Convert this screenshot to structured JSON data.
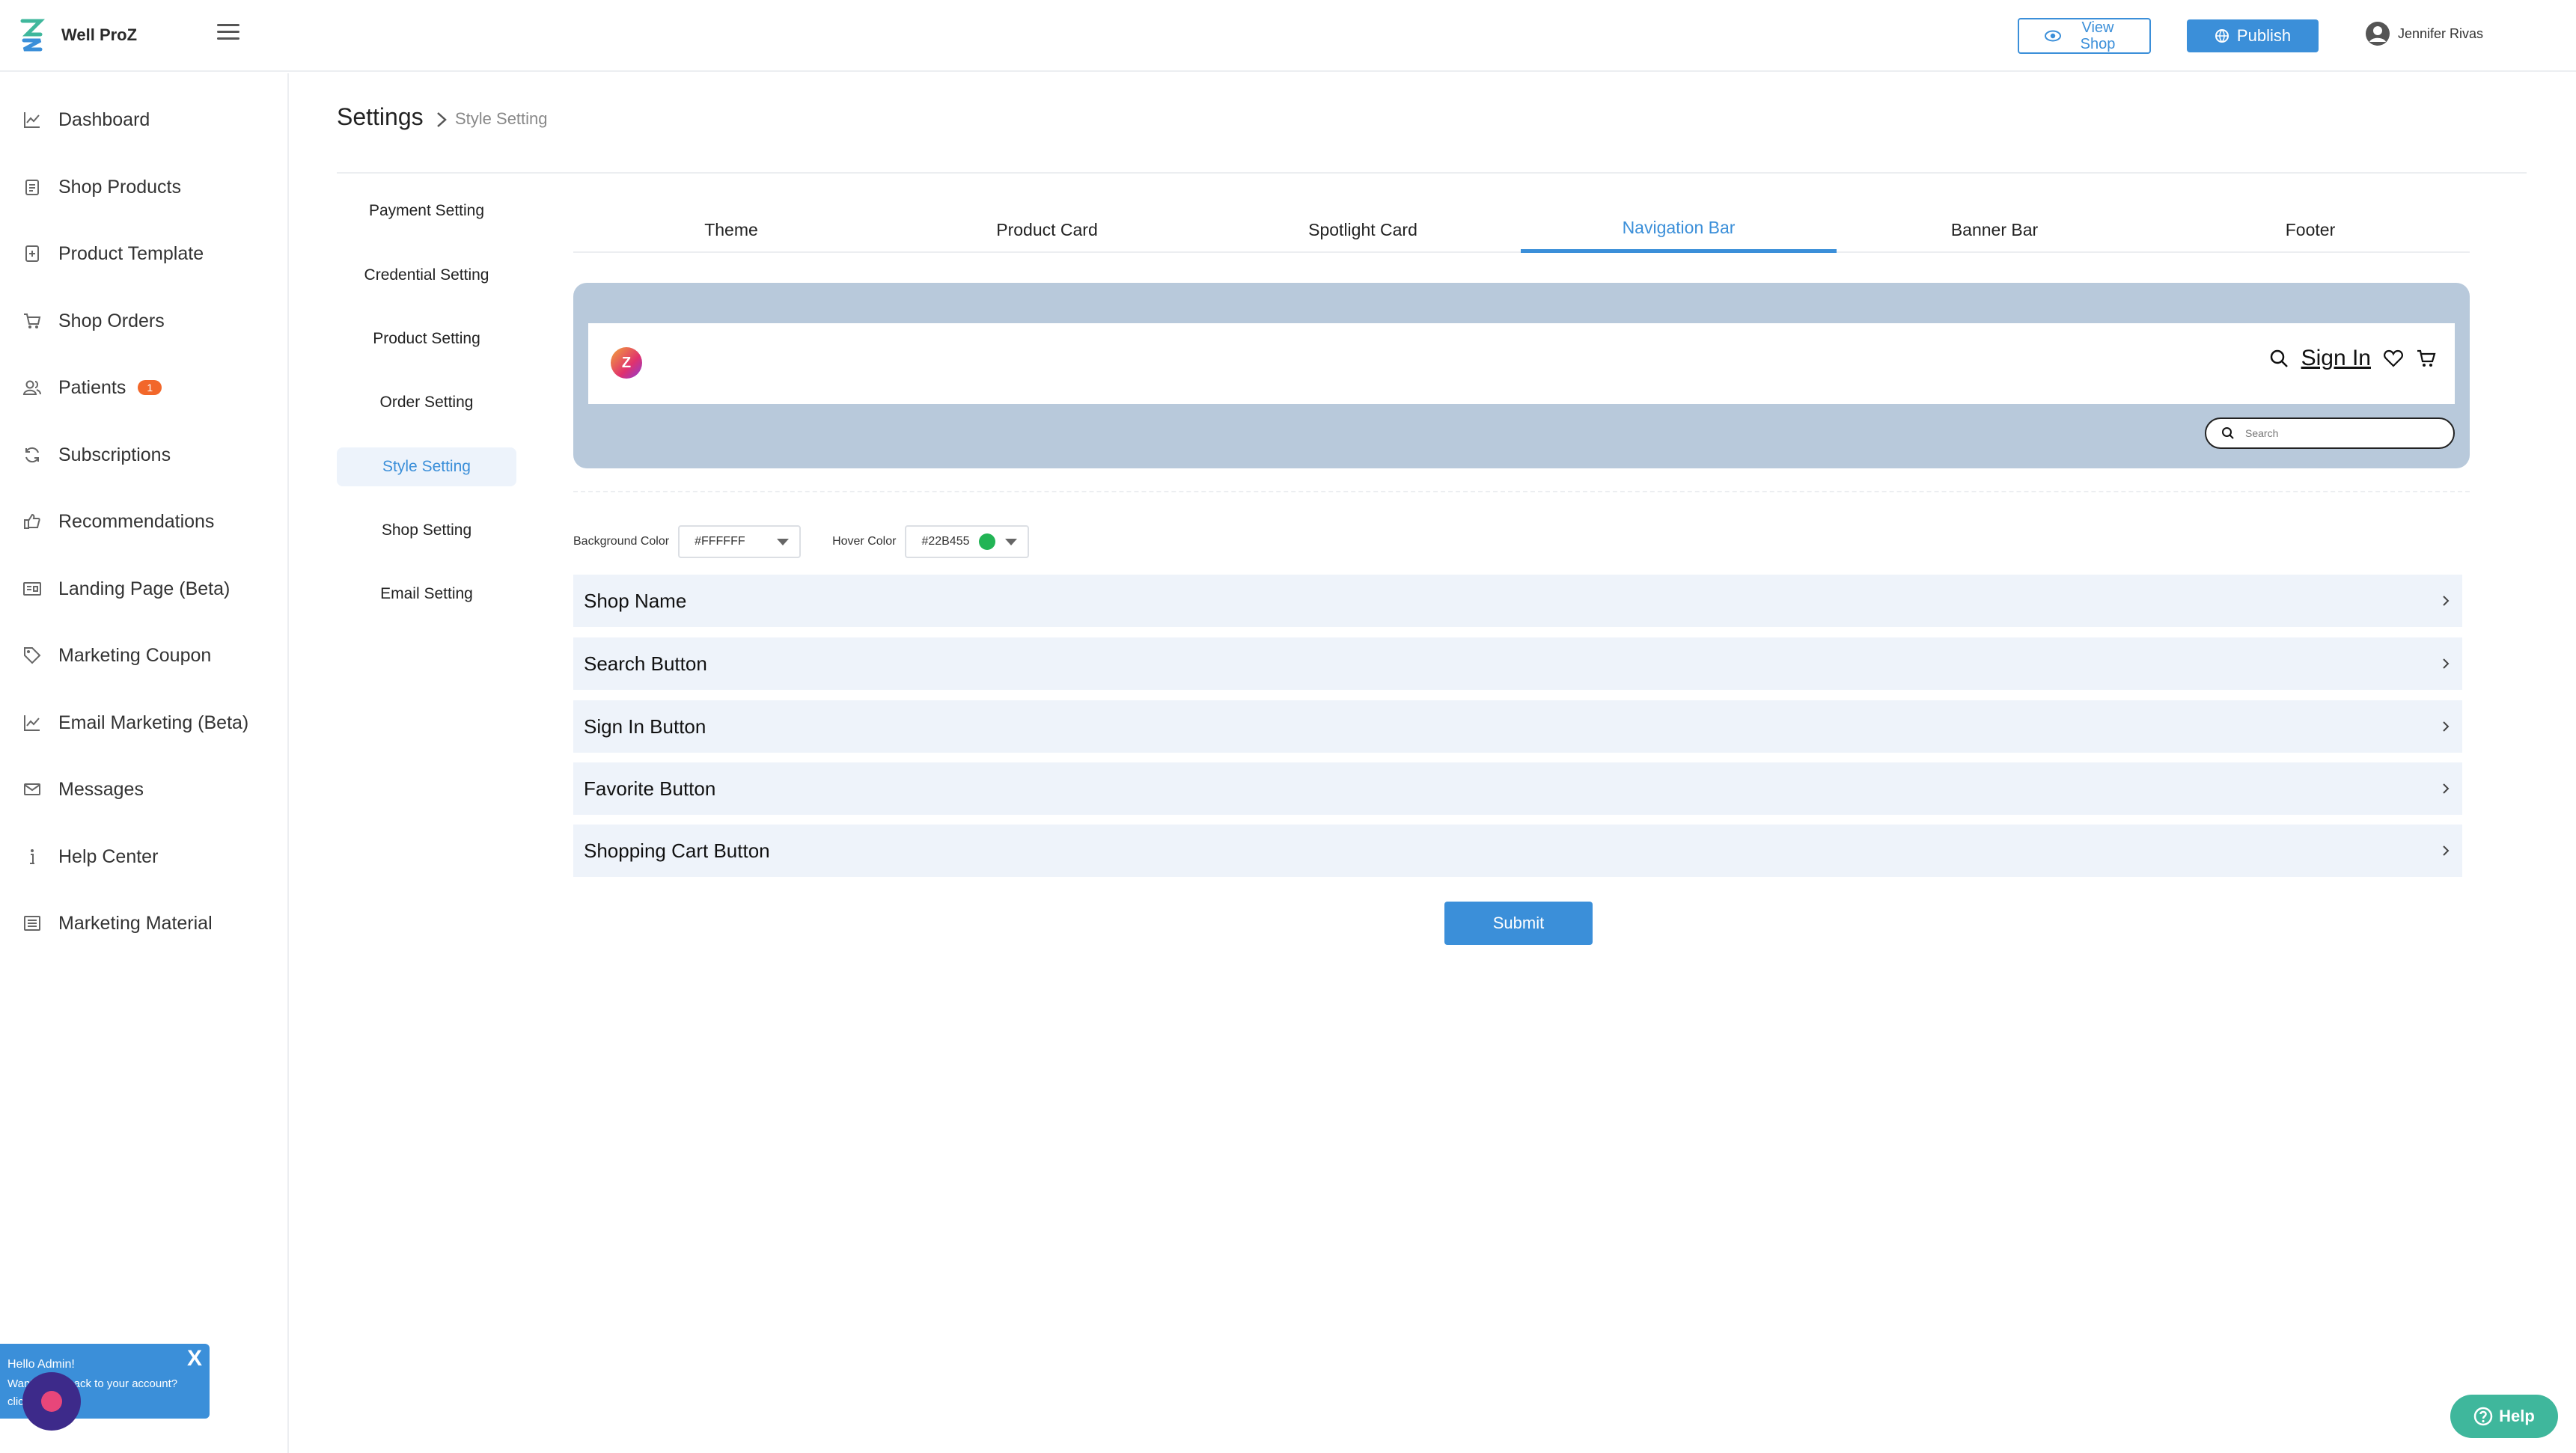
{
  "header": {
    "app_name": "Well ProZ",
    "view_shop_label": "View Shop",
    "publish_label": "Publish",
    "user_name": "Jennifer Rivas"
  },
  "sidebar": {
    "items": [
      {
        "label": "Dashboard",
        "icon": "chart-line-icon"
      },
      {
        "label": "Shop Products",
        "icon": "clipboard-icon"
      },
      {
        "label": "Product Template",
        "icon": "template-icon"
      },
      {
        "label": "Shop Orders",
        "icon": "cart-icon"
      },
      {
        "label": "Patients",
        "icon": "users-icon",
        "badge": "1"
      },
      {
        "label": "Subscriptions",
        "icon": "refresh-icon"
      },
      {
        "label": "Recommendations",
        "icon": "thumbs-up-icon"
      },
      {
        "label": "Landing Page (Beta)",
        "icon": "layout-icon"
      },
      {
        "label": "Marketing Coupon",
        "icon": "tag-icon"
      },
      {
        "label": "Email Marketing (Beta)",
        "icon": "chart-line-icon"
      },
      {
        "label": "Messages",
        "icon": "mail-icon"
      },
      {
        "label": "Help Center",
        "icon": "info-icon"
      },
      {
        "label": "Marketing Material",
        "icon": "document-icon"
      }
    ]
  },
  "breadcrumb": {
    "title": "Settings",
    "current": "Style Setting"
  },
  "settings_nav": {
    "items": [
      "Payment Setting",
      "Credential Setting",
      "Product Setting",
      "Order Setting",
      "Style Setting",
      "Shop Setting",
      "Email Setting"
    ],
    "active": "Style Setting"
  },
  "tabs": {
    "items": [
      "Theme",
      "Product Card",
      "Spotlight Card",
      "Navigation Bar",
      "Banner Bar",
      "Footer"
    ],
    "active": "Navigation Bar"
  },
  "preview": {
    "logo_letter": "Z",
    "sign_in": "Sign In",
    "search_placeholder": "Search"
  },
  "colors": {
    "background_label": "Background Color",
    "background_value": "#FFFFFF",
    "hover_label": "Hover Color",
    "hover_value": "#22B455",
    "hover_swatch": "#22b455",
    "accent": "#3b8fd9"
  },
  "sections": [
    "Shop Name",
    "Search Button",
    "Sign In Button",
    "Favorite Button",
    "Shopping Cart Button"
  ],
  "submit_label": "Submit",
  "chat": {
    "greeting": "Hello Admin!",
    "message": "Want to get back to your account? click here",
    "close": "X"
  },
  "help_label": "Help"
}
